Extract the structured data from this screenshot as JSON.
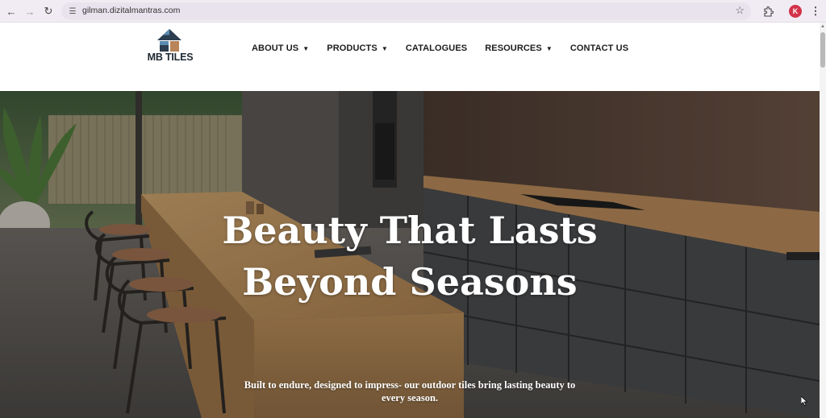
{
  "browser": {
    "url": "gilman.dizitalmantras.com",
    "profile_initial": "K",
    "icons": {
      "back": "arrow-left-icon",
      "forward": "arrow-right-icon",
      "reload": "reload-icon",
      "site_info": "tune-icon",
      "bookmark": "star-icon",
      "extensions": "puzzle-icon",
      "menu": "kebab-menu-icon"
    }
  },
  "site": {
    "logo_text": "MB TILES",
    "nav": [
      {
        "label": "ABOUT US",
        "has_dropdown": true
      },
      {
        "label": "PRODUCTS",
        "has_dropdown": true
      },
      {
        "label": "CATALOGUES",
        "has_dropdown": false
      },
      {
        "label": "RESOURCES",
        "has_dropdown": true
      },
      {
        "label": "CONTACT US",
        "has_dropdown": false
      }
    ]
  },
  "hero": {
    "title_line1": "Beauty That Lasts",
    "title_line2": "Beyond Seasons",
    "subtitle": "Built to endure, designed to impress- our outdoor tiles bring lasting beauty to every season."
  },
  "colors": {
    "chrome_bg": "#f1ecf3",
    "avatar": "#d2334a",
    "logo_dark": "#2c3e50",
    "logo_accent": "#b98459"
  }
}
